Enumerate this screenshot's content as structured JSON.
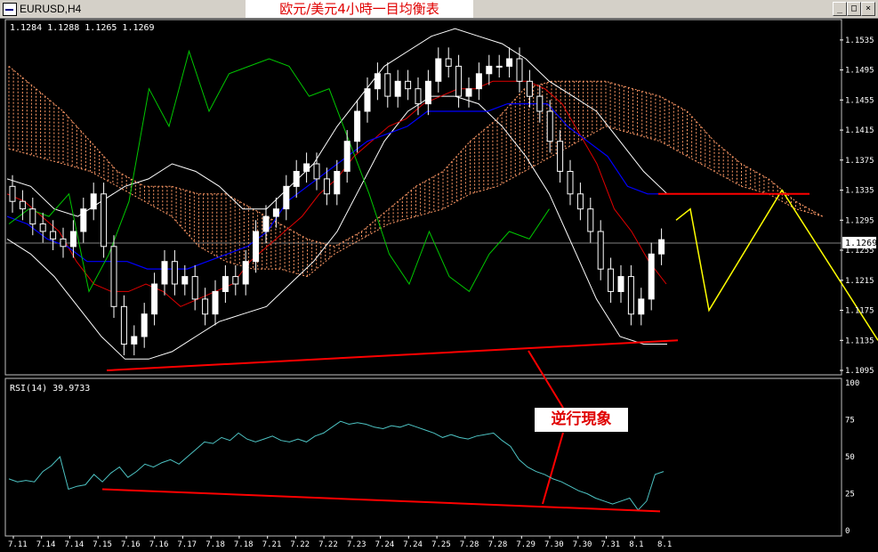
{
  "window": {
    "title": "EURUSD,H4",
    "banner": "欧元/美元4小時一目均衡表",
    "buttons": {
      "minimize": "_",
      "restore": "□",
      "close": "×"
    }
  },
  "annotation": {
    "text": "逆行現象"
  },
  "colors": {
    "background": "#000000",
    "up_candle": "#ffffff",
    "down_candle": "#ffffff",
    "chikou": "#00c800",
    "tenkan": "#e00000",
    "kijun": "#0000ff",
    "bollinger": "#ffffff",
    "kumo": "#ff9966",
    "projection": "#ffff00",
    "trendline": "#ff0000",
    "rsi": "#4dc3c3",
    "axis_text": "#ffffff"
  },
  "chart_data": [
    {
      "type": "candlestick",
      "name": "EURUSD,H4",
      "ohlc_label": "1.1284 1.1288 1.1265 1.1269",
      "current_price": 1.1269,
      "current_price_label": "1.1269",
      "ylim": [
        1.1095,
        1.1555
      ],
      "y_ticks": [
        "1.1535",
        "1.1495",
        "1.1455",
        "1.1415",
        "1.1375",
        "1.1335",
        "1.1295",
        "1.1255",
        "1.1215",
        "1.1175",
        "1.1135",
        "1.1095"
      ],
      "x_ticks": [
        "7.11",
        "7.14",
        "7.14",
        "7.15",
        "7.16",
        "7.16",
        "7.17",
        "7.18",
        "7.18",
        "7.21",
        "7.22",
        "7.22",
        "7.23",
        "7.24",
        "7.24",
        "7.25",
        "7.28",
        "7.28",
        "7.29",
        "7.30",
        "7.30",
        "7.31",
        "8.1",
        "8.1"
      ],
      "close": [
        1.132,
        1.131,
        1.129,
        1.128,
        1.127,
        1.126,
        1.128,
        1.131,
        1.133,
        1.126,
        1.118,
        1.113,
        1.114,
        1.117,
        1.121,
        1.124,
        1.121,
        1.122,
        1.119,
        1.117,
        1.12,
        1.122,
        1.121,
        1.124,
        1.128,
        1.13,
        1.131,
        1.134,
        1.136,
        1.137,
        1.135,
        1.133,
        1.136,
        1.14,
        1.144,
        1.147,
        1.149,
        1.146,
        1.148,
        1.147,
        1.145,
        1.148,
        1.151,
        1.15,
        1.146,
        1.147,
        1.149,
        1.15,
        1.15,
        1.151,
        1.148,
        1.146,
        1.144,
        1.14,
        1.136,
        1.133,
        1.131,
        1.128,
        1.123,
        1.12,
        1.122,
        1.117,
        1.119,
        1.125,
        1.1269
      ],
      "tenkan": [
        1.133,
        1.132,
        1.13,
        1.128,
        1.124,
        1.121,
        1.12,
        1.12,
        1.121,
        1.12,
        1.118,
        1.119,
        1.12,
        1.121,
        1.124,
        1.126,
        1.128,
        1.13,
        1.133,
        1.135,
        1.138,
        1.14,
        1.142,
        1.143,
        1.145,
        1.146,
        1.147,
        1.147,
        1.148,
        1.148,
        1.148,
        1.147,
        1.145,
        1.141,
        1.137,
        1.131,
        1.128,
        1.124,
        1.121
      ],
      "kijun": [
        1.13,
        1.129,
        1.127,
        1.126,
        1.124,
        1.124,
        1.124,
        1.123,
        1.123,
        1.123,
        1.124,
        1.125,
        1.126,
        1.128,
        1.132,
        1.134,
        1.136,
        1.138,
        1.14,
        1.141,
        1.142,
        1.144,
        1.144,
        1.144,
        1.144,
        1.145,
        1.145,
        1.145,
        1.142,
        1.14,
        1.138,
        1.134,
        1.133,
        1.133
      ],
      "chikou": [
        1.129,
        1.131,
        1.13,
        1.133,
        1.12,
        1.125,
        1.132,
        1.147,
        1.142,
        1.152,
        1.144,
        1.149,
        1.15,
        1.151,
        1.15,
        1.146,
        1.147,
        1.14,
        1.133,
        1.125,
        1.121,
        1.128,
        1.122,
        1.12,
        1.125,
        1.128,
        1.127,
        1.131
      ],
      "bb_upper": [
        1.135,
        1.134,
        1.131,
        1.13,
        1.132,
        1.134,
        1.135,
        1.137,
        1.136,
        1.134,
        1.131,
        1.131,
        1.134,
        1.137,
        1.142,
        1.146,
        1.15,
        1.152,
        1.154,
        1.155,
        1.154,
        1.153,
        1.151,
        1.148,
        1.146,
        1.144,
        1.14,
        1.136,
        1.133
      ],
      "bb_lower": [
        1.127,
        1.125,
        1.122,
        1.118,
        1.114,
        1.111,
        1.111,
        1.112,
        1.114,
        1.116,
        1.117,
        1.118,
        1.121,
        1.124,
        1.128,
        1.134,
        1.14,
        1.144,
        1.146,
        1.146,
        1.145,
        1.142,
        1.138,
        1.133,
        1.126,
        1.119,
        1.114,
        1.113,
        1.113
      ],
      "kumo_top": [
        1.15,
        1.147,
        1.144,
        1.14,
        1.136,
        1.134,
        1.134,
        1.133,
        1.133,
        1.131,
        1.129,
        1.127,
        1.126,
        1.128,
        1.131,
        1.134,
        1.136,
        1.14,
        1.143,
        1.147,
        1.148,
        1.148,
        1.148,
        1.147,
        1.146,
        1.144,
        1.14,
        1.137,
        1.135,
        1.132,
        1.13
      ],
      "kumo_bottom": [
        1.139,
        1.138,
        1.137,
        1.136,
        1.134,
        1.132,
        1.13,
        1.126,
        1.124,
        1.123,
        1.123,
        1.122,
        1.125,
        1.127,
        1.129,
        1.13,
        1.131,
        1.133,
        1.134,
        1.136,
        1.138,
        1.14,
        1.142,
        1.141,
        1.14,
        1.138,
        1.136,
        1.134,
        1.133,
        1.131,
        1.13
      ],
      "projection": [
        1.1295,
        1.131,
        1.1175,
        1.1335,
        1.1135
      ],
      "resistance": 1.133,
      "support": [
        1.1095,
        1.1135
      ]
    },
    {
      "type": "line",
      "name": "RSI(14)",
      "label": "RSI(14)  39.9733",
      "ylim": [
        0,
        100
      ],
      "y_ticks": [
        "100",
        "75",
        "50",
        "25",
        "0"
      ],
      "values": [
        35,
        33,
        34,
        33,
        40,
        44,
        50,
        28,
        30,
        31,
        38,
        33,
        39,
        43,
        36,
        40,
        45,
        43,
        46,
        48,
        45,
        50,
        55,
        60,
        59,
        63,
        61,
        66,
        62,
        60,
        62,
        64,
        61,
        60,
        62,
        60,
        64,
        66,
        70,
        74,
        72,
        73,
        72,
        70,
        69,
        71,
        70,
        72,
        70,
        68,
        66,
        63,
        65,
        63,
        62,
        64,
        65,
        66,
        61,
        57,
        48,
        43,
        40,
        38,
        35,
        33,
        30,
        27,
        25,
        22,
        20,
        18,
        20,
        22,
        14,
        20,
        38,
        40
      ],
      "divergence_line": [
        28,
        13
      ]
    }
  ]
}
